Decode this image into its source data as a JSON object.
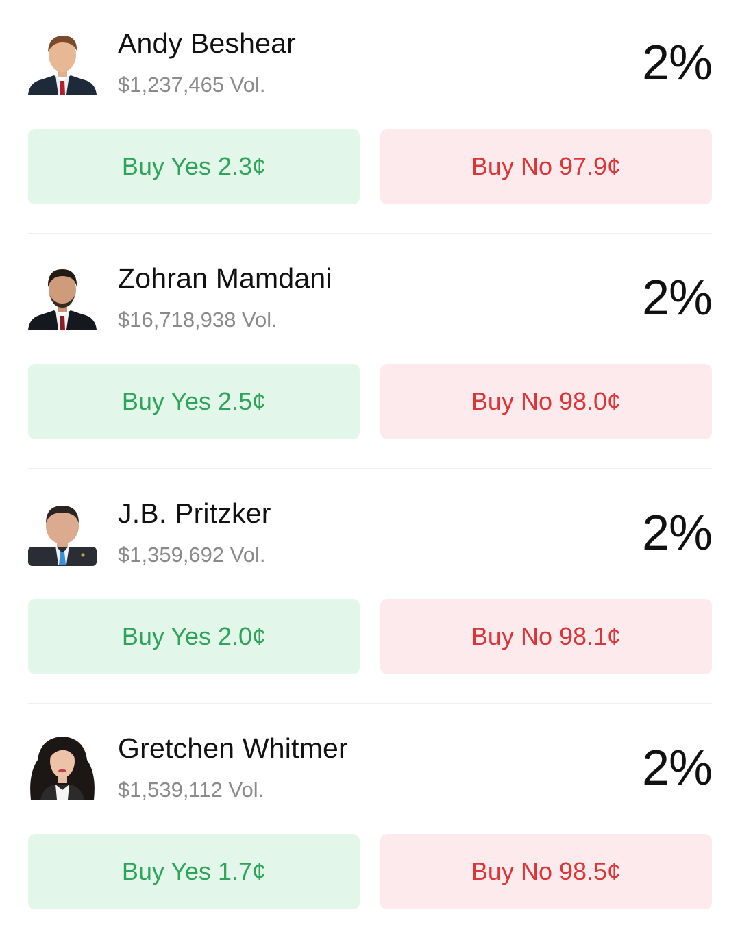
{
  "currency_symbol": "¢",
  "colors": {
    "yes_bg": "#e2f6e9",
    "yes_text": "#2ea35a",
    "no_bg": "#fdeaec",
    "no_text": "#dc3537",
    "volume_text": "#8a8a8a"
  },
  "markets": [
    {
      "name": "Andy Beshear",
      "volume": "$1,237,465",
      "volume_suffix": "Vol.",
      "chance": "2%",
      "buy_yes_label": "Buy Yes",
      "buy_yes_price": "2.3¢",
      "buy_no_label": "Buy No",
      "buy_no_price": "97.9¢",
      "avatar_icon": "candidate-photo-icon"
    },
    {
      "name": "Zohran Mamdani",
      "volume": "$16,718,938",
      "volume_suffix": "Vol.",
      "chance": "2%",
      "buy_yes_label": "Buy Yes",
      "buy_yes_price": "2.5¢",
      "buy_no_label": "Buy No",
      "buy_no_price": "98.0¢",
      "avatar_icon": "candidate-photo-icon"
    },
    {
      "name": "J.B. Pritzker",
      "volume": "$1,359,692",
      "volume_suffix": "Vol.",
      "chance": "2%",
      "buy_yes_label": "Buy Yes",
      "buy_yes_price": "2.0¢",
      "buy_no_label": "Buy No",
      "buy_no_price": "98.1¢",
      "avatar_icon": "candidate-photo-icon"
    },
    {
      "name": "Gretchen Whitmer",
      "volume": "$1,539,112",
      "volume_suffix": "Vol.",
      "chance": "2%",
      "buy_yes_label": "Buy Yes",
      "buy_yes_price": "1.7¢",
      "buy_no_label": "Buy No",
      "buy_no_price": "98.5¢",
      "avatar_icon": "candidate-photo-icon"
    }
  ]
}
